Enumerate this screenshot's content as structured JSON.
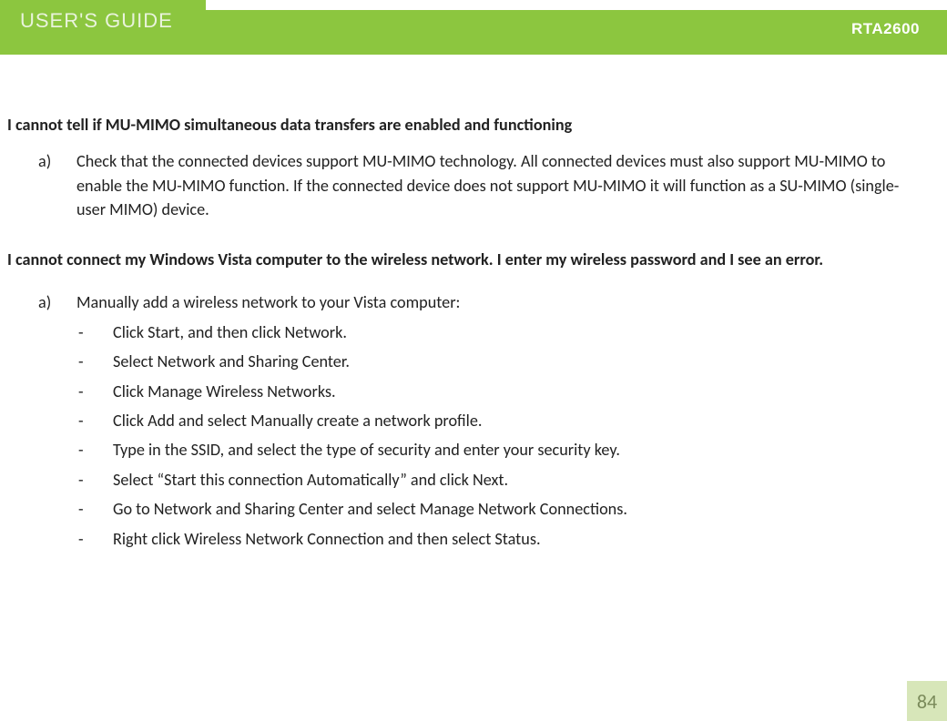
{
  "header": {
    "title": "USER'S GUIDE",
    "model": "RTA2600"
  },
  "section1": {
    "heading": "I cannot tell if MU-MIMO simultaneous data transfers are enabled and functioning",
    "items": {
      "a": "Check that the connected devices support MU-MIMO technology.  All connected devices must also support MU-MIMO to enable the MU-MIMO function.  If the connected device does not support MU-MIMO it will function as a SU-MIMO (single-user MIMO) device."
    }
  },
  "section2": {
    "heading": "I cannot connect my Windows Vista computer to the wireless network.  I enter my wireless password and I see an error.",
    "items": {
      "a": "Manually add a wireless network to your Vista computer:",
      "sub": [
        "Click Start, and then click Network.",
        "Select Network and Sharing Center.",
        "Click Manage Wireless Networks.",
        "Click Add and select Manually create a network profile.",
        "Type in the SSID, and select the type of security and enter your security key.",
        "Select “Start this connection Automatically” and click Next.",
        "Go to Network and Sharing Center and select Manage Network Connections.",
        "Right click Wireless Network Connection and then select Status."
      ]
    }
  },
  "markers": {
    "a": "a)",
    "dash": "-"
  },
  "page_number": "84"
}
